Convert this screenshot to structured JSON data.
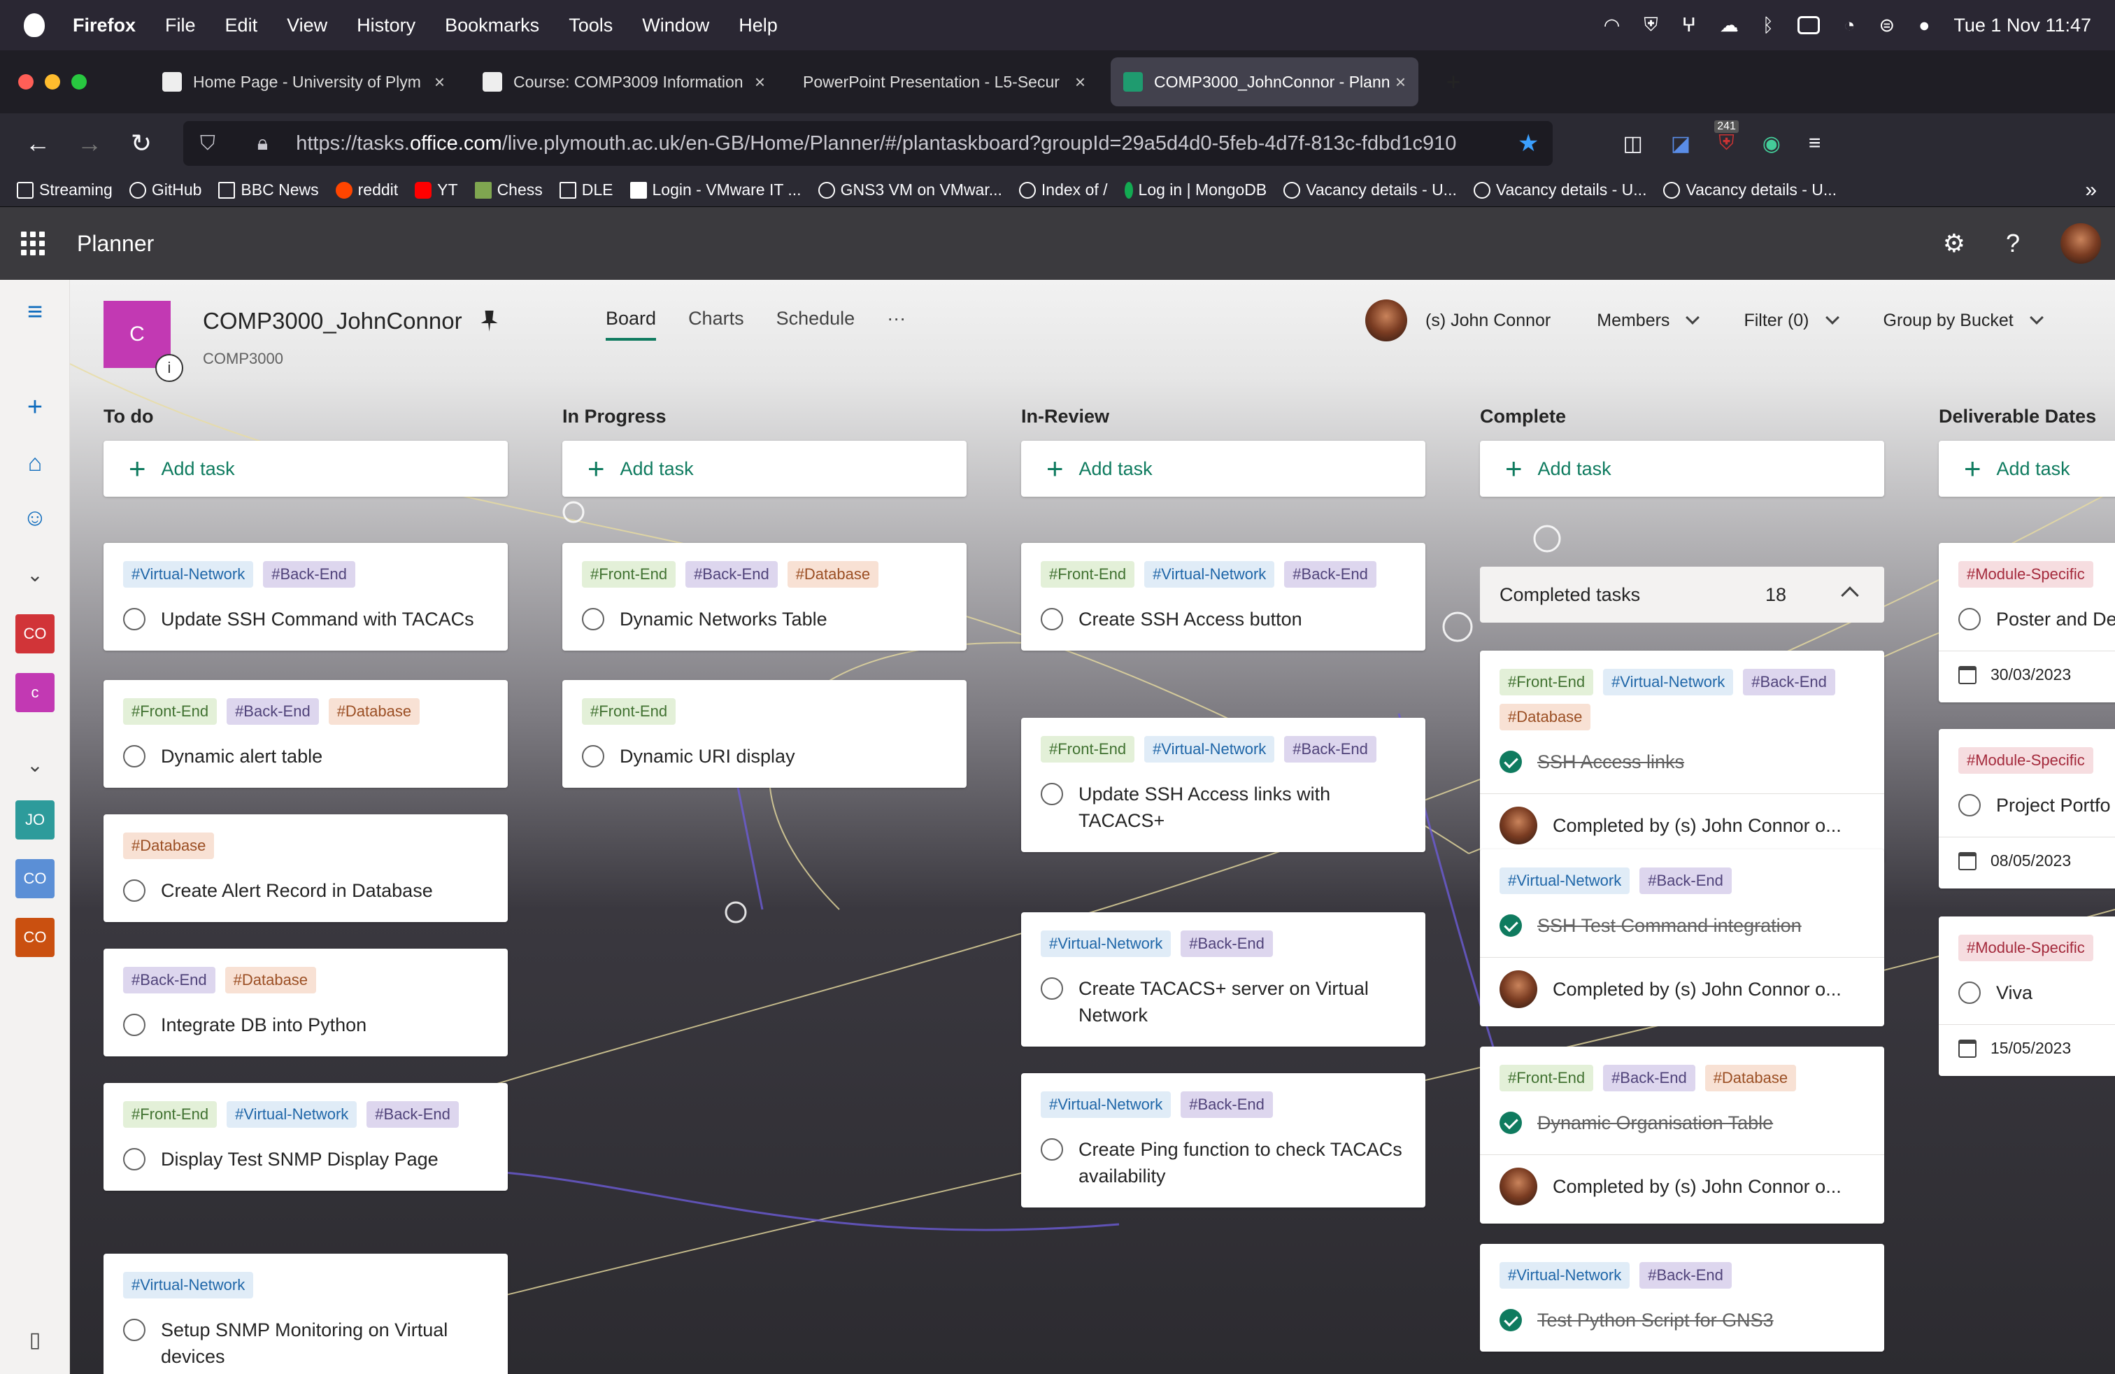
{
  "menubar": {
    "app": "Firefox",
    "items": [
      "File",
      "Edit",
      "View",
      "History",
      "Bookmarks",
      "Tools",
      "Window",
      "Help"
    ],
    "clock": "Tue 1 Nov  11:47"
  },
  "tabs": [
    {
      "title": "Home Page - University of Plym",
      "active": false
    },
    {
      "title": "Course: COMP3009 Information",
      "active": false
    },
    {
      "title": "PowerPoint Presentation - L5-Secur",
      "active": false
    },
    {
      "title": "COMP3000_JohnConnor - Plann",
      "active": true
    }
  ],
  "nav": {
    "url_prefix": "https://tasks.",
    "url_host": "office.com",
    "url_rest": "/live.plymouth.ac.uk/en-GB/Home/Planner/#/plantaskboard?groupId=29a5d4d0-5feb-4d7f-813c-fdbd1c910",
    "badge": "241"
  },
  "bookmarks": [
    "Streaming",
    "GitHub",
    "BBC News",
    "reddit",
    "YT",
    "Chess",
    "DLE",
    "Login - VMware IT ...",
    "GNS3 VM on VMwar...",
    "Index of /",
    "Log in | MongoDB",
    "Vacancy details - U...",
    "Vacancy details - U...",
    "Vacancy details - U..."
  ],
  "app": {
    "title": "Planner"
  },
  "rail": {
    "boxes": [
      {
        "label": "CO",
        "color": "#d13438"
      },
      {
        "label": "c",
        "color": "#c239b3"
      },
      {
        "label": "JO",
        "color": "#2d9b9b"
      },
      {
        "label": "CO",
        "color": "#5b8fd6"
      },
      {
        "label": "CO",
        "color": "#ca5010"
      }
    ]
  },
  "plan": {
    "logo": "C",
    "title": "COMP3000_JohnConnor",
    "group": "COMP3000"
  },
  "views": [
    "Board",
    "Charts",
    "Schedule",
    "···"
  ],
  "header_right": {
    "user": "(s) John Connor",
    "members": "Members",
    "filter": "Filter (0)",
    "group": "Group by Bucket"
  },
  "add_task": "Add task",
  "buckets": [
    {
      "name": "To do",
      "cards": [
        {
          "tags": [
            [
              "Virtual-Network",
              "vn"
            ],
            [
              "Back-End",
              "be"
            ]
          ],
          "title": "Update SSH Command with TACACs"
        },
        {
          "tags": [
            [
              "Front-End",
              "fe"
            ],
            [
              "Back-End",
              "be"
            ],
            [
              "Database",
              "db"
            ]
          ],
          "title": "Dynamic alert table"
        },
        {
          "tags": [
            [
              "Database",
              "db"
            ]
          ],
          "title": "Create Alert Record in Database"
        },
        {
          "tags": [
            [
              "Back-End",
              "be"
            ],
            [
              "Database",
              "db"
            ]
          ],
          "title": "Integrate DB into Python"
        },
        {
          "tags": [
            [
              "Front-End",
              "fe"
            ],
            [
              "Virtual-Network",
              "vn"
            ],
            [
              "Back-End",
              "be"
            ]
          ],
          "title": "Display Test SNMP Display Page"
        },
        {
          "tags": [
            [
              "Virtual-Network",
              "vn"
            ]
          ],
          "title": "Setup SNMP Monitoring on Virtual devices"
        }
      ]
    },
    {
      "name": "In Progress",
      "cards": [
        {
          "tags": [
            [
              "Front-End",
              "fe"
            ],
            [
              "Back-End",
              "be"
            ],
            [
              "Database",
              "db"
            ]
          ],
          "title": "Dynamic Networks Table"
        },
        {
          "tags": [
            [
              "Front-End",
              "fe"
            ]
          ],
          "title": "Dynamic URI display"
        }
      ]
    },
    {
      "name": "In-Review",
      "cards": [
        {
          "tags": [
            [
              "Front-End",
              "fe"
            ],
            [
              "Virtual-Network",
              "vn"
            ],
            [
              "Back-End",
              "be"
            ]
          ],
          "title": "Create SSH Access button"
        },
        {
          "tags": [
            [
              "Front-End",
              "fe"
            ],
            [
              "Virtual-Network",
              "vn"
            ],
            [
              "Back-End",
              "be"
            ]
          ],
          "title": "Update SSH Access links with TACACS+"
        },
        {
          "tags": [
            [
              "Virtual-Network",
              "vn"
            ],
            [
              "Back-End",
              "be"
            ]
          ],
          "title": "Create TACACS+ server on Virtual Network"
        },
        {
          "tags": [
            [
              "Virtual-Network",
              "vn"
            ],
            [
              "Back-End",
              "be"
            ]
          ],
          "title": "Create Ping function to check TACACs availability"
        }
      ]
    },
    {
      "name": "Complete",
      "completed_label": "Completed tasks",
      "completed_count": "18",
      "cards": [
        {
          "tags": [
            [
              "Front-End",
              "fe"
            ],
            [
              "Virtual-Network",
              "vn"
            ],
            [
              "Back-End",
              "be"
            ],
            [
              "Database",
              "db"
            ]
          ],
          "title": "SSH Access links",
          "done": true,
          "completed_by": "Completed by (s) John Connor o..."
        },
        {
          "tags": [
            [
              "Virtual-Network",
              "vn"
            ],
            [
              "Back-End",
              "be"
            ]
          ],
          "title": "SSH Test Command integration",
          "done": true,
          "completed_by": "Completed by (s) John Connor o..."
        },
        {
          "tags": [
            [
              "Front-End",
              "fe"
            ],
            [
              "Back-End",
              "be"
            ],
            [
              "Database",
              "db"
            ]
          ],
          "title": "Dynamic Organisation Table",
          "done": true,
          "completed_by": "Completed by (s) John Connor o..."
        },
        {
          "tags": [
            [
              "Virtual-Network",
              "vn"
            ],
            [
              "Back-End",
              "be"
            ]
          ],
          "title": "Test Python Script for GNS3",
          "done": true
        }
      ]
    },
    {
      "name": "Deliverable Dates",
      "cards": [
        {
          "tags": [
            [
              "Module-Specific",
              "ms"
            ]
          ],
          "title": "Poster and De",
          "date": "30/03/2023"
        },
        {
          "tags": [
            [
              "Module-Specific",
              "ms"
            ]
          ],
          "title": "Project Portfo",
          "date": "08/05/2023"
        },
        {
          "tags": [
            [
              "Module-Specific",
              "ms"
            ]
          ],
          "title": "Viva",
          "date": "15/05/2023"
        }
      ]
    }
  ]
}
